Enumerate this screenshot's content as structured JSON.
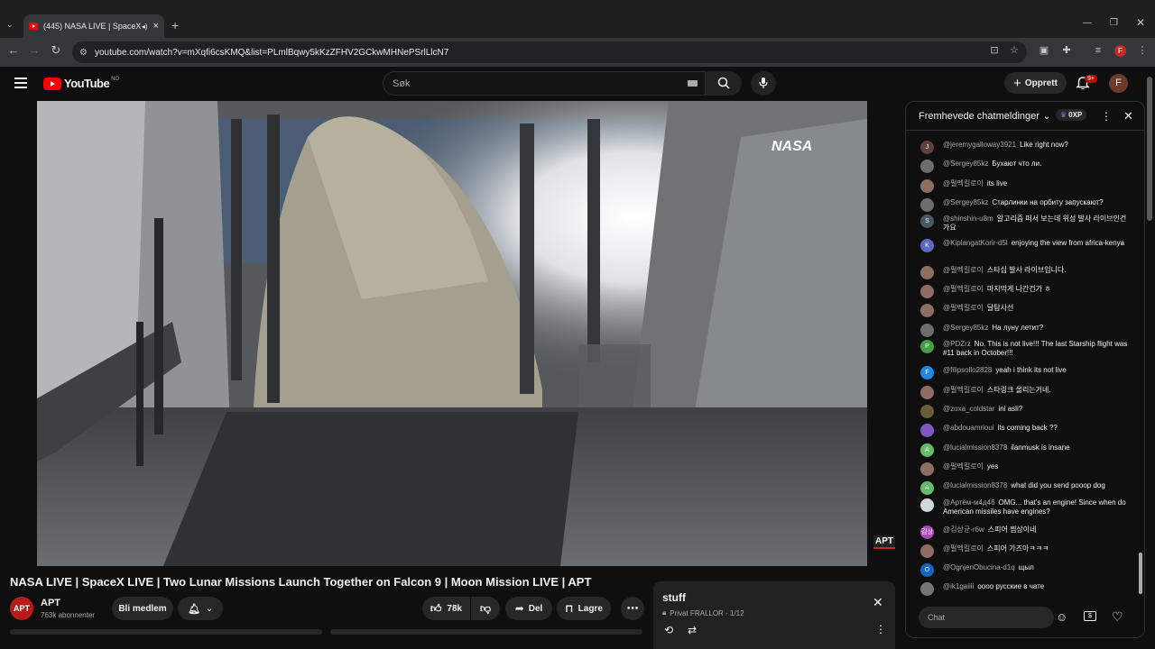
{
  "browser": {
    "tab_title": "(445) NASA LIVE | SpaceX LI",
    "url": "youtube.com/watch?v=mXqfi6csKMQ&list=PLmlBqwy5kKzZFHV2GCkwMHNePSrlLlcN7"
  },
  "header": {
    "logo_text": "YouTube",
    "region": "NO",
    "search_placeholder": "Søk",
    "create_label": "Opprett",
    "notif_count": "9+",
    "avatar_letter": "F"
  },
  "video": {
    "watermark": "NASA",
    "channel_bug": "APT",
    "title": "NASA LIVE | SpaceX LIVE | Two Lunar Missions Launch Together on Falcon 9 | Moon Mission LIVE | APT"
  },
  "channel": {
    "name": "APT",
    "subs": "763k abonnenter",
    "join_label": "Bli medlem"
  },
  "actions": {
    "likes": "78k",
    "share_label": "Del",
    "save_label": "Lagre"
  },
  "playlist": {
    "name": "stuff",
    "meta": "Privat FRALLOR - 1/12"
  },
  "chat": {
    "header": "Fremhevede chatmeldinger",
    "xp": "0XP",
    "input_placeholder": "Chat",
    "messages": [
      {
        "author": "@jeremygalloway3921",
        "text": "Like right now?",
        "avatar": "J",
        "color": "#5d4037"
      },
      {
        "author": "@Sergey85kz",
        "text": "Бухают что ли.",
        "avatar": "",
        "color": "#6d6d6d"
      },
      {
        "author": "@펄멕킬로이",
        "text": "its live",
        "avatar": "",
        "color": "#8d6e63"
      },
      {
        "author": "@Sergey85kz",
        "text": "Старлинки на орбиту запускают?",
        "avatar": "",
        "color": "#6d6d6d"
      },
      {
        "author": "@shinshin-u8m",
        "text": "알고리즘 떠서 보는데 위성 발사 라이브인건가요",
        "avatar": "S",
        "color": "#455a64"
      },
      {
        "author": "@KiplangatKorir-d5l",
        "text": "enjoying the view from africa-kenya",
        "avatar": "K",
        "color": "#5c6bc0"
      },
      {
        "author": "@펄멕킬로이",
        "text": "스타십 발사 라이브입니다.",
        "avatar": "",
        "color": "#8d6e63"
      },
      {
        "author": "@펄멕킬로이",
        "text": "마지막게 나간건가 ㅎ",
        "avatar": "",
        "color": "#8d6e63"
      },
      {
        "author": "@펄멕킬로이",
        "text": "달탐사선",
        "avatar": "",
        "color": "#8d6e63"
      },
      {
        "author": "@Sergey85kz",
        "text": "На луну летит?",
        "avatar": "",
        "color": "#6d6d6d"
      },
      {
        "author": "@PDZrz",
        "text": "No. This is not live!!! The last Starship flight was #11 back in October!!!",
        "avatar": "P",
        "color": "#43a047"
      },
      {
        "author": "@filipsollo2828",
        "text": "yeah i think its not live",
        "avatar": "F",
        "color": "#1e88e5"
      },
      {
        "author": "@펄멕킬로이",
        "text": "스타링크 올리는거네.",
        "avatar": "",
        "color": "#8d6e63"
      },
      {
        "author": "@zoxa_coldstar",
        "text": "ini asli?",
        "avatar": "",
        "color": "#6a5d3a"
      },
      {
        "author": "@abdouamrioui",
        "text": "its coming back ??",
        "avatar": "",
        "color": "#7e57c2"
      },
      {
        "author": "@lucialmission8378",
        "text": "ilanmusk is insane",
        "avatar": "A",
        "color": "#66bb6a"
      },
      {
        "author": "@펄멕킬로이",
        "text": "yes",
        "avatar": "",
        "color": "#8d6e63"
      },
      {
        "author": "@lucialmission8378",
        "text": "what did you send pooop dog",
        "avatar": "A",
        "color": "#66bb6a"
      },
      {
        "author": "@Артём-м4д46",
        "text": "OMG... that's an engine! Since when do American missiles have engines?",
        "avatar": "",
        "color": "#cfd8dc"
      },
      {
        "author": "@김상균-r6w",
        "text": "스피어 찜상이네",
        "avatar": "김상",
        "color": "#ab47bc"
      },
      {
        "author": "@펄멕킬로이",
        "text": "스피어 가즈아ㅋㅋㅋ",
        "avatar": "",
        "color": "#8d6e63"
      },
      {
        "author": "@OgnjenObucina-d1q",
        "text": "щыл",
        "avatar": "O",
        "color": "#1565c0"
      },
      {
        "author": "@ik1gaiiii",
        "text": "оооо русские в чате",
        "avatar": "",
        "color": "#757575"
      }
    ]
  },
  "icons": {
    "notif": "bell-icon",
    "menu": "hamburger-icon",
    "search": "search-icon",
    "mic": "mic-icon"
  }
}
